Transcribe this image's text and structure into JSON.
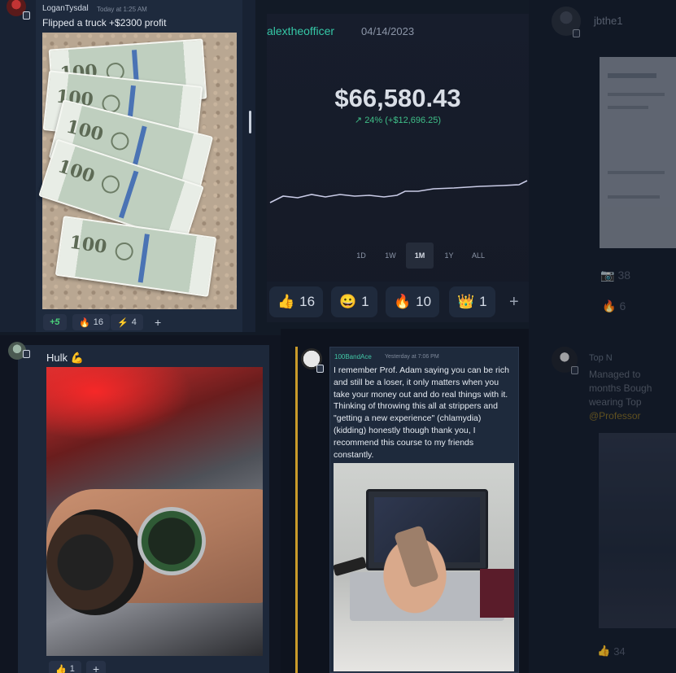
{
  "post1": {
    "username": "LoganTysdal",
    "timestamp": "Today at 1:25 AM",
    "message": "Flipped a truck +$2300 profit",
    "bill_denomination": "100",
    "reactions": [
      {
        "icon": "green-plus",
        "label": "+5",
        "count": ""
      },
      {
        "icon": "fire-emoji",
        "label": "🔥",
        "count": "16"
      },
      {
        "icon": "lightning-emoji",
        "label": "⚡",
        "count": "4"
      },
      {
        "icon": "add-reaction-icon",
        "label": "+",
        "count": ""
      }
    ]
  },
  "stats_card": {
    "handle": "alextheofficer",
    "date": "04/14/2023",
    "balance": "$66,580.43",
    "change": "24% (+$12,696.25)",
    "change_arrow": "↗",
    "accent_color": "#35c7a6",
    "ranges": [
      "1D",
      "1W",
      "1M",
      "1Y",
      "ALL"
    ],
    "active_range": "1M",
    "reactions": [
      {
        "icon": "thumbs-up-emoji",
        "label": "👍",
        "count": "16"
      },
      {
        "icon": "grinning-emoji",
        "label": "😀",
        "count": "1"
      },
      {
        "icon": "fire-emoji",
        "label": "🔥",
        "count": "10"
      },
      {
        "icon": "crown-emoji",
        "label": "👑",
        "count": "1"
      },
      {
        "icon": "add-reaction-icon",
        "label": "+",
        "count": ""
      }
    ]
  },
  "post_right_top": {
    "username": "jbthe1",
    "reactions": [
      {
        "icon": "camera-emoji",
        "label": "📷",
        "count": "38"
      },
      {
        "icon": "fire-emoji",
        "label": "🔥",
        "count": "6"
      }
    ]
  },
  "post2": {
    "message": "Hulk 💪",
    "reactions": [
      {
        "icon": "thumbs-up-emoji",
        "label": "👍",
        "count": "1"
      },
      {
        "icon": "add-reaction-icon",
        "label": "+",
        "count": ""
      }
    ]
  },
  "post3": {
    "username": "100BandAce",
    "timestamp": "Yesterday at 7:06 PM",
    "message": "I remember Prof. Adam saying you can be rich and still be a loser, it only matters when you take your money out and do real things with it. Thinking of throwing this all at strippers and \"getting a new experience\" (chlamydia) (kidding) honestly though thank you, I recommend this course to my friends constantly."
  },
  "post_right_bottom": {
    "username": "Top N",
    "message_lines": [
      "Managed to",
      "months Bough",
      "wearing Top",
      "@Professor"
    ],
    "reactions": [
      {
        "icon": "thumbs-up-emoji",
        "label": "👍",
        "count": "34"
      }
    ]
  }
}
